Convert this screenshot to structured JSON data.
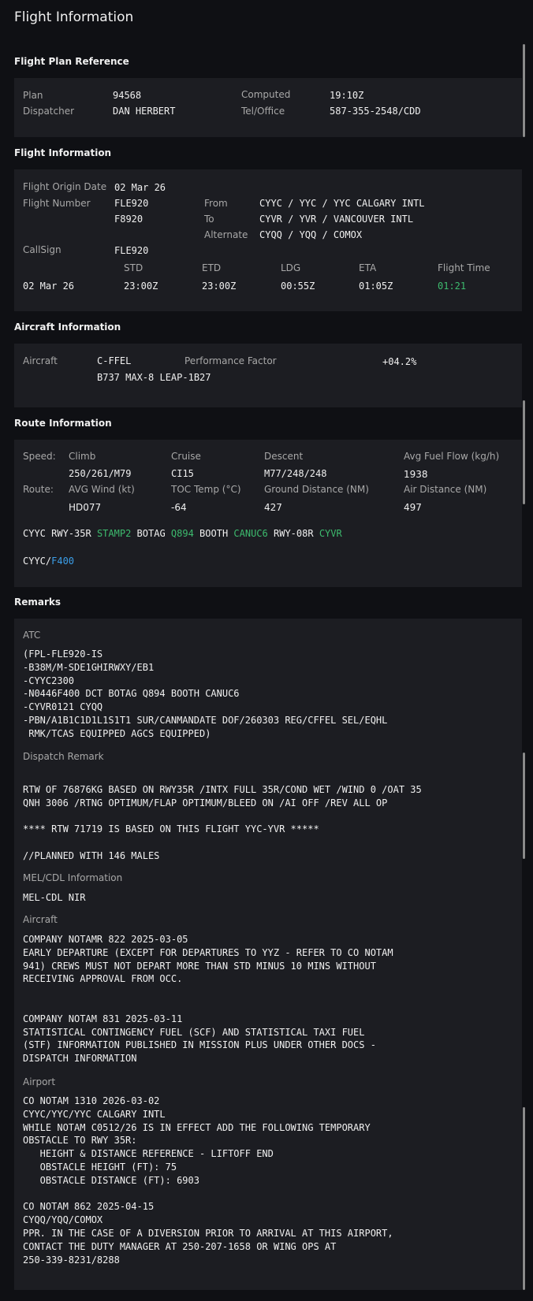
{
  "page_title": "Flight Information",
  "plan_ref": {
    "title": "Flight Plan Reference",
    "plan_label": "Plan",
    "plan_value": "94568",
    "computed_label": "Computed",
    "computed_value": "19:10Z",
    "dispatcher_label": "Dispatcher",
    "dispatcher_value": "DAN HERBERT",
    "tel_label": "Tel/Office",
    "tel_value": "587-355-2548/CDD"
  },
  "flight_info": {
    "title": "Flight Information",
    "origin_date_label": "Flight Origin Date",
    "origin_date_value": "02 Mar 26",
    "flight_number_label": "Flight Number",
    "flight_number_value": "FLE920",
    "flight_number_alt": "F8920",
    "from_label": "From",
    "from_value": "CYYC / YYC / YYC CALGARY INTL",
    "to_label": "To",
    "to_value": "CYVR / YVR / VANCOUVER INTL",
    "alternate_label": "Alternate",
    "alternate_value": "CYQQ / YQQ / COMOX",
    "callsign_label": "CallSign",
    "callsign_value": "FLE920",
    "std_label": "STD",
    "etd_label": "ETD",
    "ldg_label": "LDG",
    "eta_label": "ETA",
    "flight_time_label": "Flight Time",
    "date_value": "02 Mar 26",
    "std_value": "23:00Z",
    "etd_value": "23:00Z",
    "ldg_value": "00:55Z",
    "eta_value": "01:05Z",
    "flight_time_value": "01:21"
  },
  "aircraft_info": {
    "title": "Aircraft Information",
    "aircraft_label": "Aircraft",
    "registration": "C-FFEL",
    "type": "B737 MAX-8 LEAP-1B27",
    "perf_label": "Performance Factor",
    "perf_value": "+04.2%"
  },
  "route_info": {
    "title": "Route Information",
    "speed_label": "Speed:",
    "route_label": "Route:",
    "climb_label": "Climb",
    "climb_value": "250/261/M79",
    "cruise_label": "Cruise",
    "cruise_value": "CI15",
    "descent_label": "Descent",
    "descent_value": "M77/248/248",
    "fuel_flow_label": "Avg Fuel Flow (kg/h)",
    "fuel_flow_value": "1938",
    "wind_label": "AVG Wind (kt)",
    "wind_value": "HD077",
    "toc_label": "TOC Temp (°C)",
    "toc_value": "-64",
    "ground_label": "Ground Distance (NM)",
    "ground_value": "427",
    "air_label": "Air Distance (NM)",
    "air_value": "497",
    "route_tokens": [
      {
        "text": "CYYC",
        "color": "#f0f0f0"
      },
      {
        "text": "RWY-35R",
        "color": "#f0f0f0"
      },
      {
        "text": "STAMP2",
        "color": "#3dbb6e"
      },
      {
        "text": "BOTAG",
        "color": "#f0f0f0"
      },
      {
        "text": "Q894",
        "color": "#3dbb6e"
      },
      {
        "text": "BOOTH",
        "color": "#f0f0f0"
      },
      {
        "text": "CANUC6",
        "color": "#3dbb6e"
      },
      {
        "text": "RWY-08R",
        "color": "#f0f0f0"
      },
      {
        "text": "CYVR",
        "color": "#3dbb6e"
      }
    ],
    "level_prefix": "CYYC/",
    "level_value": "F400"
  },
  "remarks": {
    "title": "Remarks",
    "atc_label": "ATC",
    "atc_text": "(FPL-FLE920-IS\n-B38M/M-SDE1GHIRWXY/EB1\n-CYYC2300\n-N0446F400 DCT BOTAG Q894 BOOTH CANUC6\n-CYVR0121 CYQQ\n-PBN/A1B1C1D1L1S1T1 SUR/CANMANDATE DOF/260303 REG/CFFEL SEL/EQHL\n RMK/TCAS EQUIPPED AGCS EQUIPPED)",
    "dispatch_label": "Dispatch Remark",
    "dispatch_text": "RTW OF 76876KG BASED ON RWY35R /INTX FULL 35R/COND WET /WIND 0 /OAT 35\nQNH 3006 /RTNG OPTIMUM/FLAP OPTIMUM/BLEED ON /AI OFF /REV ALL OP\n\n**** RTW 71719 IS BASED ON THIS FLIGHT YYC-YVR *****\n\n//PLANNED WITH 146 MALES",
    "mel_label": "MEL/CDL Information",
    "mel_text": "MEL-CDL NIR",
    "aircraft_label": "Aircraft",
    "aircraft_text": "COMPANY NOTAMR 822 2025-03-05\nEARLY DEPARTURE (EXCEPT FOR DEPARTURES TO YYZ - REFER TO CO NOTAM\n941) CREWS MUST NOT DEPART MORE THAN STD MINUS 10 MINS WITHOUT\nRECEIVING APPROVAL FROM OCC.\n\n\nCOMPANY NOTAM 831 2025-03-11\nSTATISTICAL CONTINGENCY FUEL (SCF) AND STATISTICAL TAXI FUEL\n(STF) INFORMATION PUBLISHED IN MISSION PLUS UNDER OTHER DOCS -\nDISPATCH INFORMATION",
    "airport_label": "Airport",
    "airport_text": "CO NOTAM 1310 2026-03-02\nCYYC/YYC/YYC CALGARY INTL\nWHILE NOTAM C0512/26 IS IN EFFECT ADD THE FOLLOWING TEMPORARY\nOBSTACLE TO RWY 35R:\n   HEIGHT & DISTANCE REFERENCE - LIFTOFF END\n   OBSTACLE HEIGHT (FT): 75\n   OBSTACLE DISTANCE (FT): 6903\n\nCO NOTAM 862 2025-04-15\nCYQQ/YQQ/COMOX\nPPR. IN THE CASE OF A DIVERSION PRIOR TO ARRIVAL AT THIS AIRPORT,\nCONTACT THE DUTY MANAGER AT 250-207-1658 OR WING OPS AT\n250-339-8231/8288"
  }
}
